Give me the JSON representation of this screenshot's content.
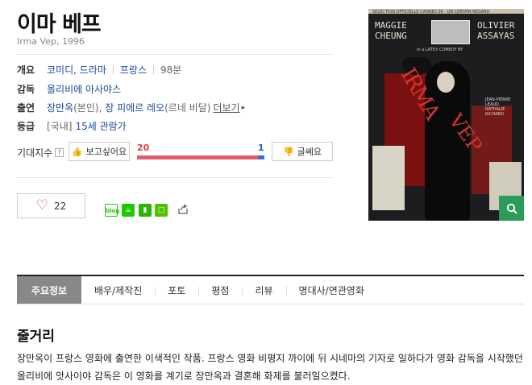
{
  "movie": {
    "title": "이마 베프",
    "subtitle": "Irma Vep, 1996"
  },
  "info": {
    "overview": {
      "label": "개요",
      "genre": "코미디, 드라마",
      "country": "프랑스",
      "runtime": "98분"
    },
    "director": {
      "label": "감독",
      "name": "올리비에 아사야스"
    },
    "cast": {
      "label": "출연",
      "actor1": "장만옥",
      "role1": "(본인)",
      "actor2": "장 피에르 레오",
      "role2": "(르네 비달)",
      "more": "더보기"
    },
    "rating": {
      "label": "등급",
      "region": "[국내]",
      "value": "15세 관람가"
    }
  },
  "expectation": {
    "label": "기대지수",
    "help": "?",
    "want_label": "보고싶어요",
    "want_count": "20",
    "no_label": "글쎄요",
    "no_count": "1",
    "want_fraction": 0.95
  },
  "like": {
    "count": "22"
  },
  "share": {
    "icons": [
      "blog-icon",
      "cafe-icon",
      "bookmark-icon",
      "memo-icon",
      "share-icon"
    ],
    "blog_text": "blog"
  },
  "poster": {
    "headline": "SELECTION OFFICIELLE CANNES 96 · UN CERTAIN REGARD",
    "name_left_1": "MAGGIE",
    "name_left_2": "CHEUNG",
    "name_right_1": "OLIVIER",
    "name_right_2": "ASSAYAS",
    "inset_caption": "in a LATEX COMEDY BY",
    "title_1": "IRMA",
    "title_2": "VEP",
    "credit_1": "JEAN-PIERRE LÉAUD",
    "credit_2": "NATHALIE RICHARD"
  },
  "tabs": [
    {
      "label": "주요정보",
      "active": true
    },
    {
      "label": "배우/제작진"
    },
    {
      "label": "포토"
    },
    {
      "label": "평점"
    },
    {
      "label": "리뷰"
    },
    {
      "label": "명대사/연관영화"
    }
  ],
  "synopsis": {
    "title": "줄거리",
    "text": "장만옥이 프랑스 영화에 출연한 이색적인 작품. 프랑스 영화 비평지 까이에 뒤 시네마의 기자로 일하다가 영화 감독을 시작했던 올리비에 앗사이야 감독은 이 영화를 계기로 장만옥과 결혼해 화제를 불러일으켰다."
  },
  "colors": {
    "link_blue": "#1a4aa0",
    "want_red": "#e55b6a",
    "no_blue": "#3a6fd0",
    "zoom_green": "#2c9b5a",
    "tab_active": "#888888"
  }
}
